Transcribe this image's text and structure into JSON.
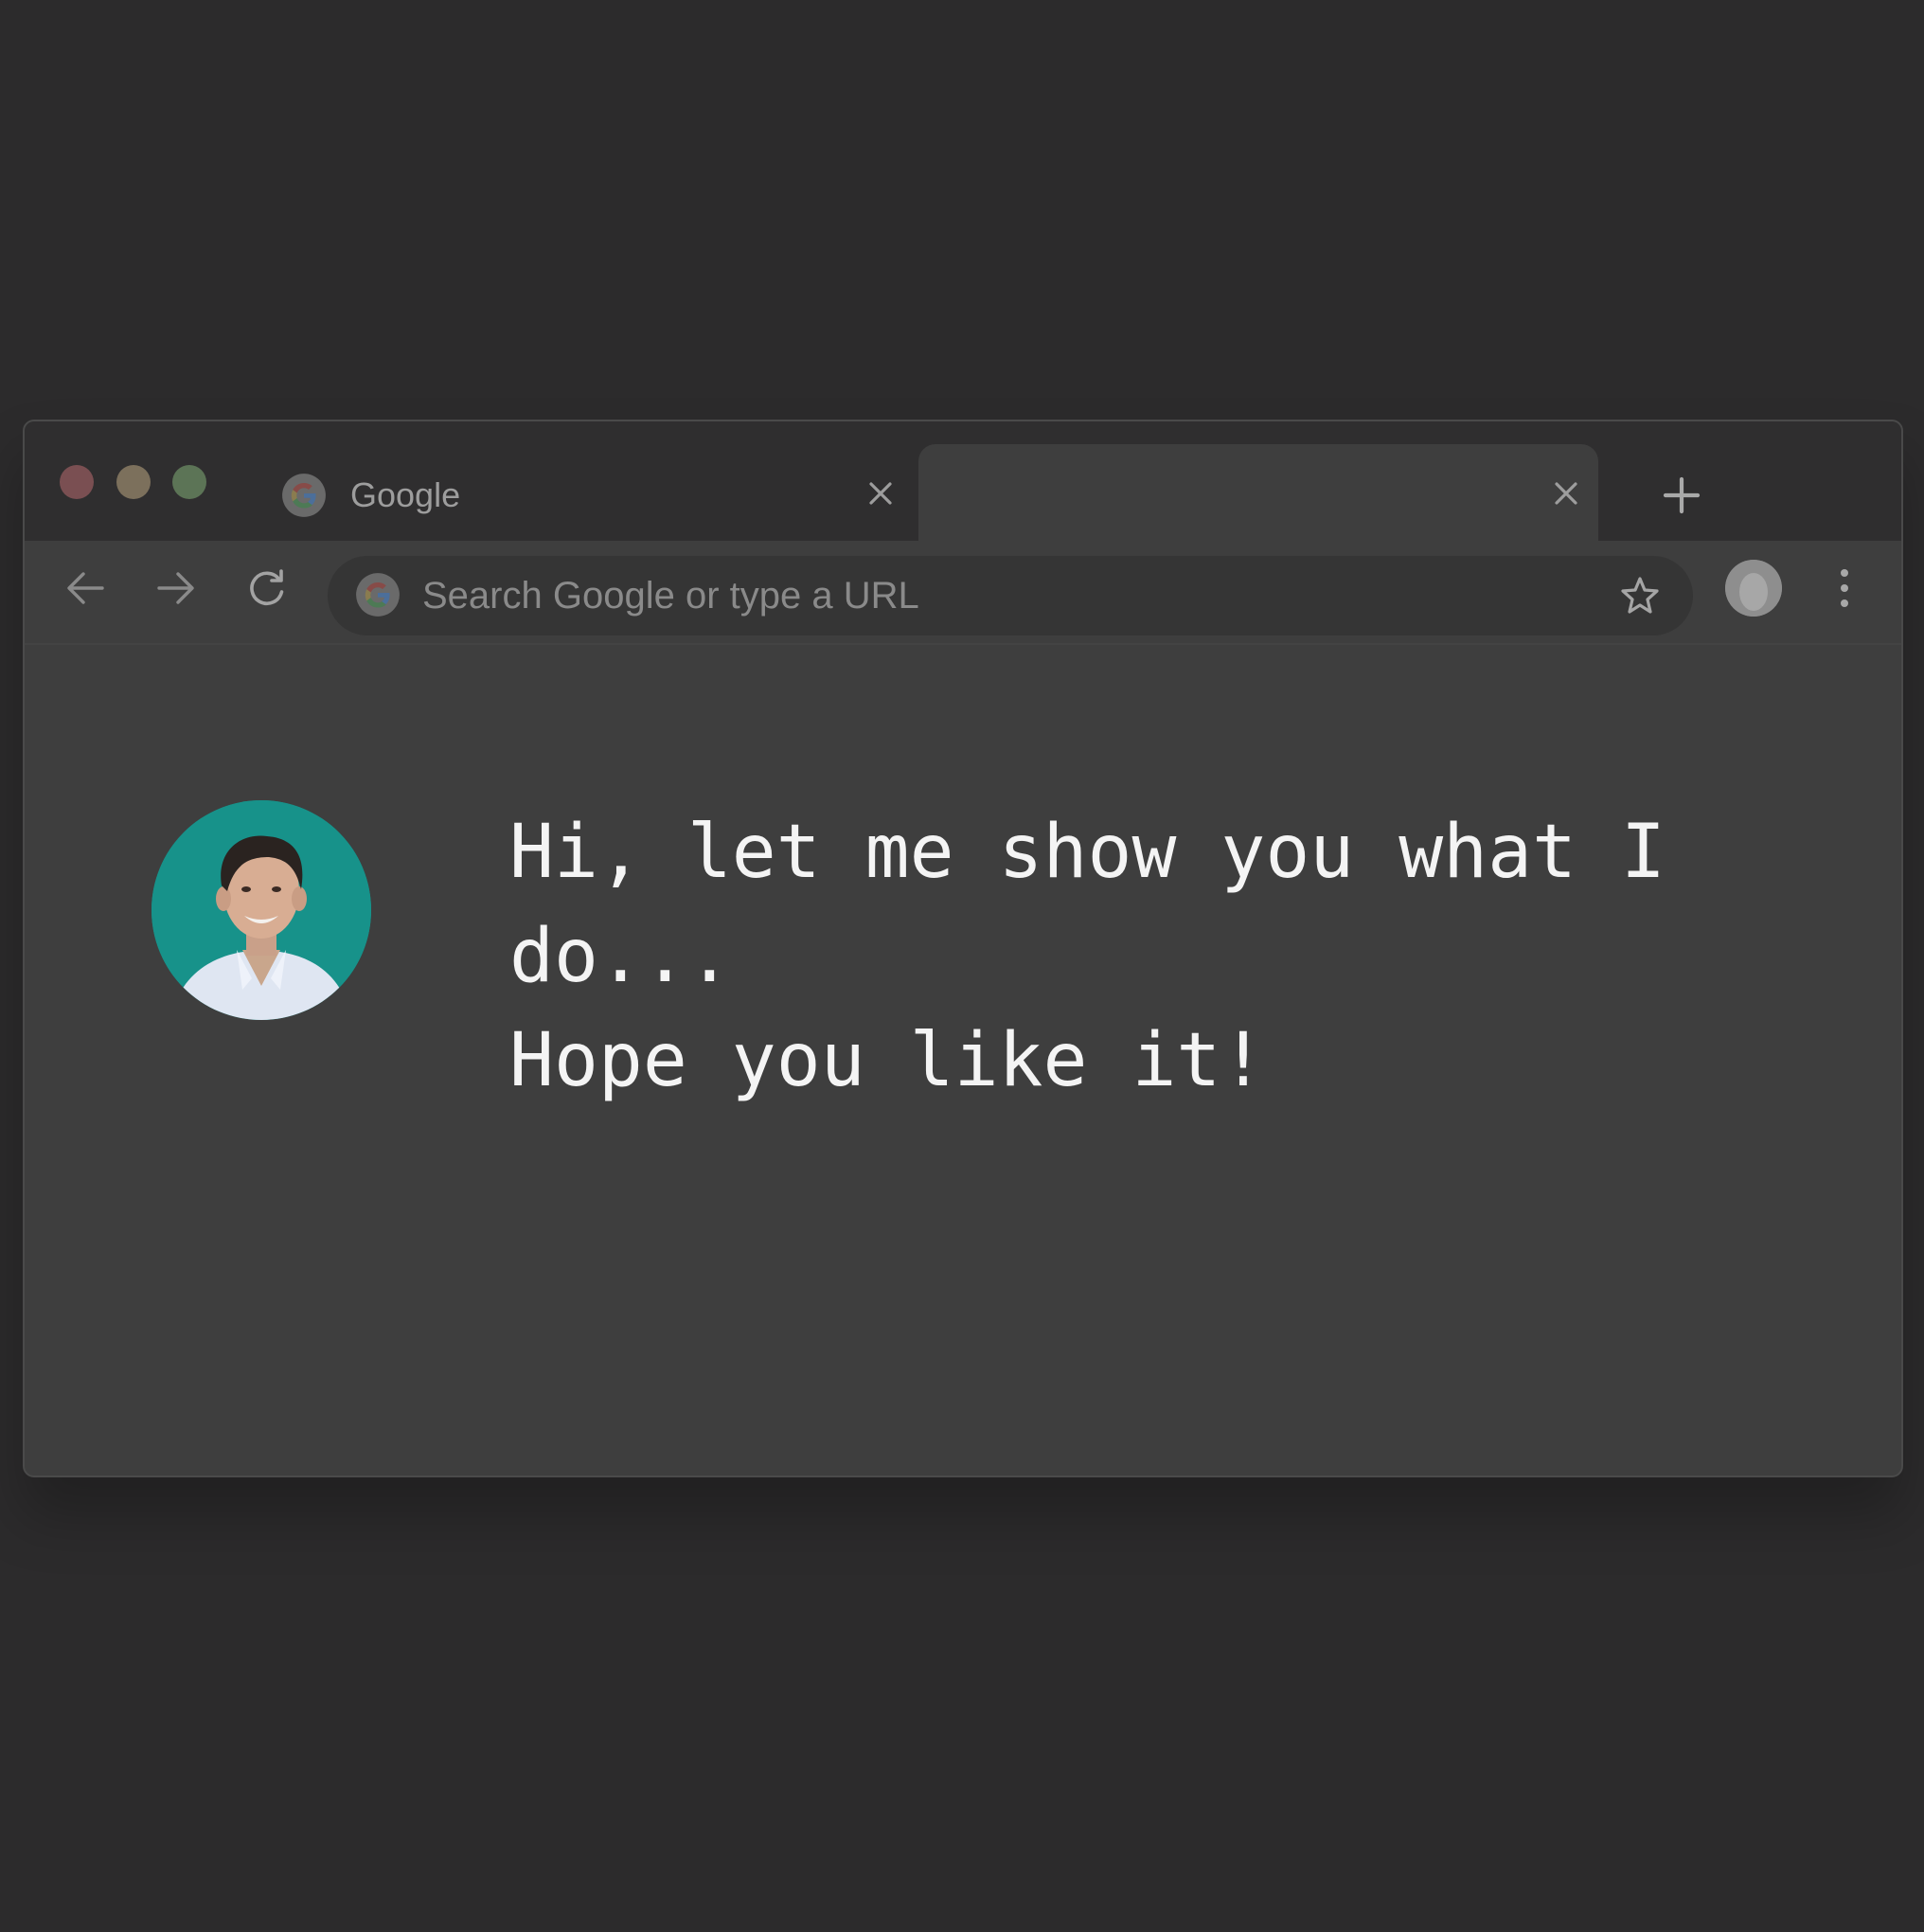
{
  "browser": {
    "tabs": [
      {
        "label": "Google",
        "icon": "google-g-icon",
        "active": false
      },
      {
        "label": "",
        "icon": "",
        "active": true
      }
    ],
    "traffic_lights": {
      "close": "#7a4f52",
      "minimize": "#7c705c",
      "maximize": "#5c7456"
    },
    "omnibox": {
      "placeholder": "Search Google or type a URL",
      "icon": "google-g-icon"
    },
    "colors": {
      "background": "#2c2b2c",
      "tab_strip": "#2f2e2f",
      "content": "#3e3e3e",
      "avatar_bg": "#17928a"
    }
  },
  "content": {
    "line1": "Hi, let me show you what I do...",
    "line2": "Hope you like it!"
  }
}
